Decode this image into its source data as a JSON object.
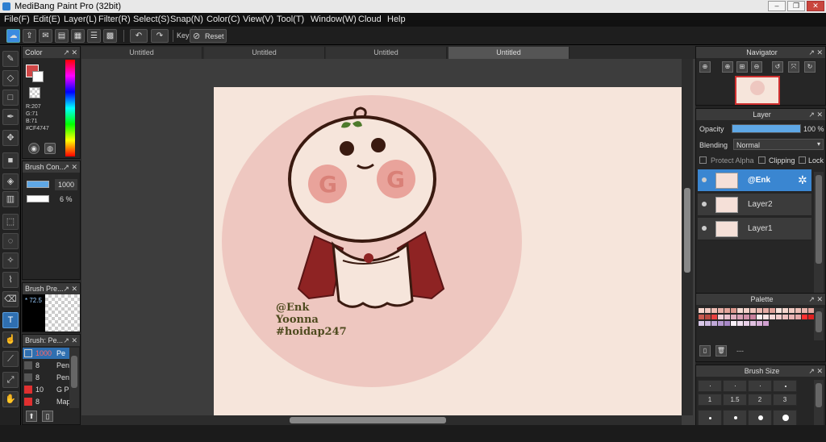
{
  "app": {
    "title": "MediBang Paint Pro (32bit)"
  },
  "menu": [
    "File(F)",
    "Edit(E)",
    "Layer(L)",
    "Filter(R)",
    "Select(S)",
    "Snap(N)",
    "Color(C)",
    "View(V)",
    "Tool(T)",
    "Window(W)",
    "Cloud",
    "Help"
  ],
  "toolbar": {
    "key_label": "Key",
    "reset_label": "Reset"
  },
  "tabs": [
    "Untitled",
    "Untitled",
    "Untitled",
    "Untitled"
  ],
  "color_panel": {
    "title": "Color",
    "r": "R:207",
    "g": "G:71",
    "b": "B:71",
    "hex": "#CF4747",
    "main_color": "#cf4747"
  },
  "brush_control": {
    "title": "Brush Con...",
    "size": "1000",
    "opacity": "6 %"
  },
  "brush_preview": {
    "title": "Brush Pre...",
    "value": "72.5"
  },
  "brush_list": {
    "title": "Brush: Pe...",
    "items": [
      {
        "size": "1000",
        "name": "Pe",
        "color": "#2f6fb0"
      },
      {
        "size": "8",
        "name": "Pen",
        "color": "#555"
      },
      {
        "size": "8",
        "name": "Pen",
        "color": "#555"
      },
      {
        "size": "10",
        "name": "G P",
        "color": "#e03030"
      },
      {
        "size": "8",
        "name": "Map",
        "color": "#e03030"
      }
    ]
  },
  "canvas": {
    "signature": [
      "@Enk",
      "Yoonna",
      "#hoidap247"
    ]
  },
  "navigator": {
    "title": "Navigator"
  },
  "layer_panel": {
    "title": "Layer",
    "opacity_label": "Opacity",
    "opacity_value": "100 %",
    "opacity_fraction": 1.0,
    "blending_label": "Blending",
    "blending_value": "Normal",
    "protect_alpha": "Protect Alpha",
    "clipping": "Clipping",
    "lock": "Lock",
    "layers": [
      {
        "name": "@Enk",
        "active": true
      },
      {
        "name": "Layer2",
        "active": false
      },
      {
        "name": "Layer1",
        "active": false
      }
    ]
  },
  "palette": {
    "title": "Palette",
    "dash": "---",
    "colors": [
      "#f5d5cc",
      "#f0c8c0",
      "#eebcb2",
      "#e8b0a8",
      "#e2a49a",
      "#dc988e",
      "#f6dcd4",
      "#f2d0c8",
      "#eec4bc",
      "#e9b8b0",
      "#e4aca4",
      "#dfa098",
      "#f8e2dc",
      "#f4d6ce",
      "#f0cac2",
      "#ecbeb6",
      "#e8b2aa",
      "#e4a69e",
      "#c95a50",
      "#b84a40",
      "#e84040",
      "#f0d0d8",
      "#e8c0cc",
      "#e0b0c0",
      "#d8a0b4",
      "#d090a8",
      "#c8809c",
      "#fff0f0",
      "#fbe4e4",
      "#f6d8d8",
      "#f2cccc",
      "#eec0c0",
      "#e9b4b4",
      "#e5a8a8",
      "#ff3030",
      "#e02020",
      "#d8c8e8",
      "#ccb8e0",
      "#c0a8d8",
      "#b498d0",
      "#a888c8",
      "#f8f0f8",
      "#f0e0f0",
      "#e8d0e8",
      "#e0c0e0",
      "#d8b0d8",
      "#d0a0d0"
    ]
  },
  "brush_size": {
    "title": "Brush Size",
    "labels": [
      "1",
      "1.5",
      "2",
      "3"
    ]
  }
}
